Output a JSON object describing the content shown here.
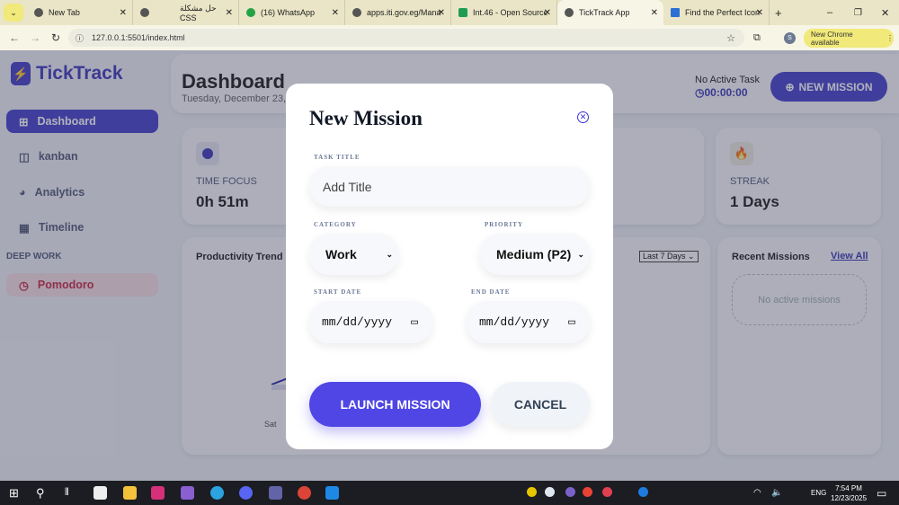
{
  "browser": {
    "tabs": [
      {
        "label": "New Tab"
      },
      {
        "label": "حل مشكلة CSS"
      },
      {
        "label": "(16) WhatsApp"
      },
      {
        "label": "apps.iti.gov.eg/Mana"
      },
      {
        "label": "Int.46 - Open Source"
      },
      {
        "label": "TickTrack App",
        "active": true
      },
      {
        "label": "Find the Perfect Icon"
      }
    ],
    "url": "127.0.0.1:5501/index.html",
    "update_label": "New Chrome available",
    "profile": "S"
  },
  "app": {
    "name": "TickTrack",
    "accent": "#3d37c9",
    "sidebar": {
      "items": [
        {
          "label": "Dashboard",
          "icon": "grid-icon",
          "active": true
        },
        {
          "label": "kanban",
          "icon": "kanban-icon"
        },
        {
          "label": "Analytics",
          "icon": "pie-chart-icon"
        },
        {
          "label": "Timeline",
          "icon": "calendar-icon"
        }
      ],
      "section": "DEEP WORK",
      "pomodoro": "Pomodoro"
    },
    "header": {
      "title": "Dashboard",
      "date": "Tuesday, December 23,",
      "task_status": "No Active Task",
      "timer": "00:00:00",
      "new_mission": "NEW MISSION"
    },
    "stats": [
      {
        "label": "TIME FOCUS",
        "value": "0h 51m",
        "icon": "clock-icon"
      },
      {
        "label": "STREAK",
        "value": "1 Days",
        "icon": "fire-icon"
      }
    ],
    "chart": {
      "title": "Productivity Trend",
      "range": "Last 7 Days",
      "visible_tick": "Sat"
    },
    "recent": {
      "title": "Recent Missions",
      "view_all": "View All",
      "empty": "No active missions"
    }
  },
  "modal": {
    "title": "New Mission",
    "task_title_label": "TASK TITLE",
    "task_title_placeholder": "Add Title",
    "category_label": "CATEGORY",
    "category_value": "Work",
    "priority_label": "PRIORITY",
    "priority_value": "Medium (P2)",
    "start_label": "START DATE",
    "end_label": "END DATE",
    "date_placeholder": "mm/dd/yyyy",
    "launch": "LAUNCH MISSION",
    "cancel": "CANCEL"
  },
  "taskbar": {
    "time": "7:54 PM",
    "date": "12/23/2025",
    "lang": "ENG"
  }
}
